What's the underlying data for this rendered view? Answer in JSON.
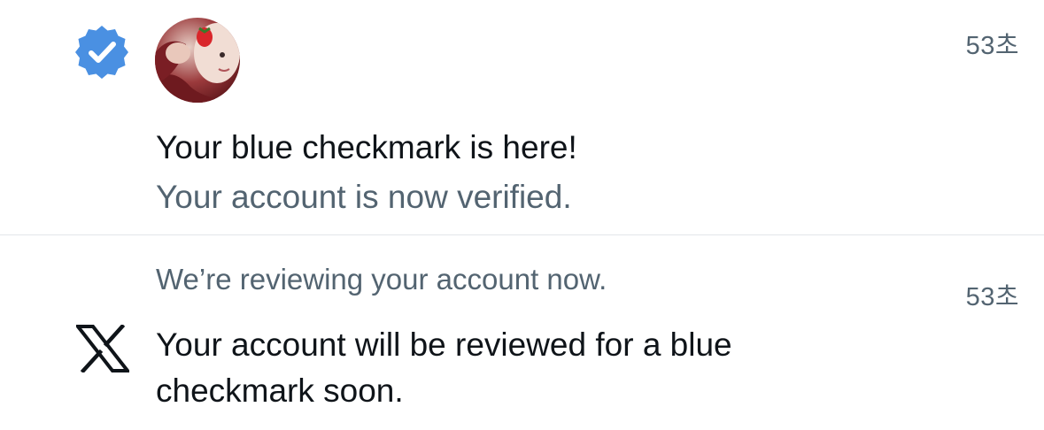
{
  "notifications": [
    {
      "icon": "verified-badge-icon",
      "avatar": "user-avatar",
      "timestamp": "53초",
      "title": "Your blue checkmark is here!",
      "subtitle": "Your account is now verified."
    },
    {
      "icon": "x-logo-icon",
      "timestamp": "53초",
      "header": "We’re reviewing your account now.",
      "body": "Your account will be reviewed for a blue checkmark soon."
    }
  ],
  "colors": {
    "verified_blue": "#4a90e2",
    "primary_text": "#0f1419",
    "secondary_text": "#536471",
    "divider": "#e3e6ea"
  }
}
